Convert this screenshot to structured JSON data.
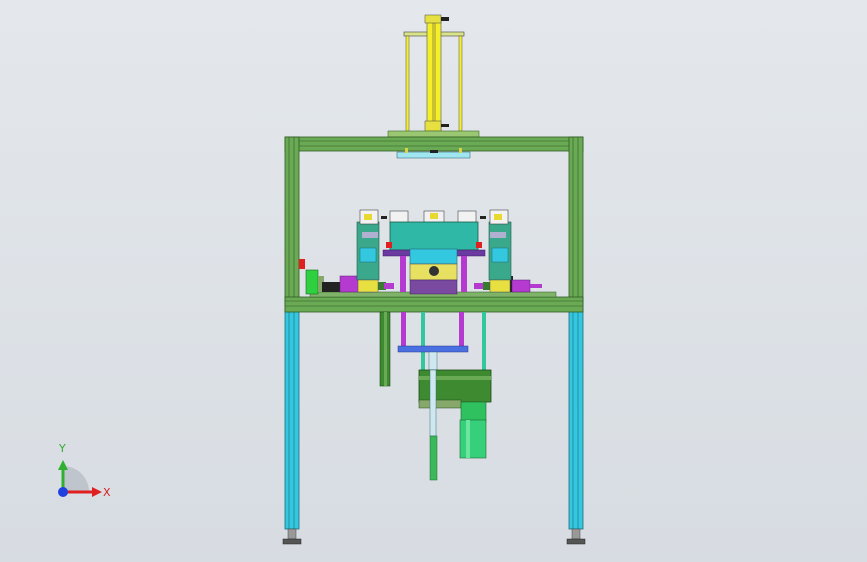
{
  "view": {
    "background": "#dde1e6",
    "colors": {
      "frame_green": "#5e9a4b",
      "frame_dark": "#2f5a22",
      "leg_cyan": "#33c7e0",
      "yellow": "#f5ef2a",
      "magenta": "#b43ad0",
      "teal": "#2fb8a6",
      "motor_green": "#36d07a",
      "blue_plate": "#4a6fe0"
    }
  },
  "triad": {
    "x_label": "X",
    "y_label": "Y",
    "x_color": "#e02020",
    "y_color": "#30b030",
    "z_color": "#2040e0"
  }
}
